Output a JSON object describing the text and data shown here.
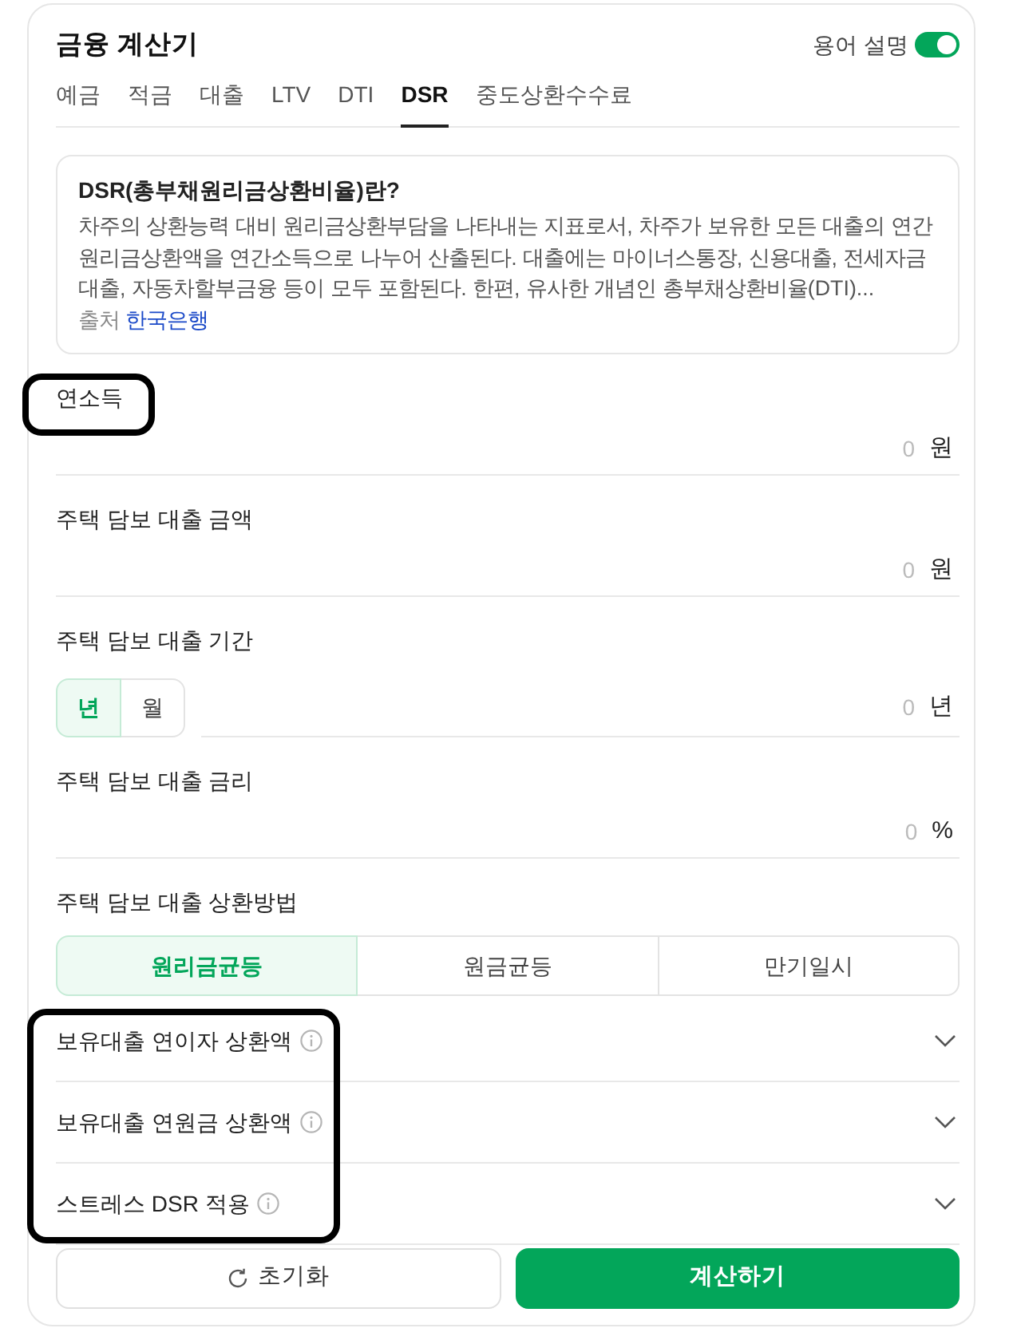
{
  "header": {
    "title": "금융 계산기",
    "glossary_toggle": {
      "label": "용어 설명",
      "on": true
    }
  },
  "tabs": [
    {
      "label": "예금",
      "selected": false
    },
    {
      "label": "적금",
      "selected": false
    },
    {
      "label": "대출",
      "selected": false
    },
    {
      "label": "LTV",
      "selected": false
    },
    {
      "label": "DTI",
      "selected": false
    },
    {
      "label": "DSR",
      "selected": true
    },
    {
      "label": "중도상환수수료",
      "selected": false
    }
  ],
  "info": {
    "title": "DSR(총부채원리금상환비율)란?",
    "body": "차주의 상환능력 대비 원리금상환부담을 나타내는 지표로서, 차주가 보유한 모든 대출의 연간 원리금상환액을 연간소득으로 나누어 산출된다. 대출에는 마이너스통장, 신용대출, 전세자금대출, 자동차할부금융 등이 모두 포함된다. 한편, 유사한 개념인 총부채상환비율(DTI)...",
    "source_label": "출처",
    "source_link": "한국은행"
  },
  "fields": [
    {
      "kind": "amount",
      "label": "연소득",
      "placeholder": "0",
      "unit": "원",
      "highlighted": true
    },
    {
      "kind": "amount",
      "label": "주택 담보 대출 금액",
      "placeholder": "0",
      "unit": "원",
      "highlighted": false
    },
    {
      "kind": "period",
      "label": "주택 담보 대출 기간",
      "period_units": [
        {
          "label": "년",
          "selected": true
        },
        {
          "label": "월",
          "selected": false
        }
      ],
      "placeholder": "0",
      "unit": "년",
      "highlighted": false
    },
    {
      "kind": "amount",
      "label": "주택 담보 대출 금리",
      "placeholder": "0",
      "unit": "%",
      "highlighted": false
    },
    {
      "kind": "choice",
      "label": "주택 담보 대출 상환방법",
      "options": [
        {
          "label": "원리금균등",
          "selected": true
        },
        {
          "label": "원금균등",
          "selected": false
        },
        {
          "label": "만기일시",
          "selected": false
        }
      ],
      "highlighted": false
    }
  ],
  "optional_sections": {
    "highlighted": true,
    "items": [
      {
        "label": "보유대출 연이자 상환액",
        "expanded": false
      },
      {
        "label": "보유대출 연원금 상환액",
        "expanded": false
      },
      {
        "label": "스트레스 DSR 적용",
        "expanded": false
      }
    ]
  },
  "buttons": [
    {
      "kind": "reset",
      "label": "초기화"
    },
    {
      "kind": "submit",
      "label": "계산하기"
    }
  ]
}
